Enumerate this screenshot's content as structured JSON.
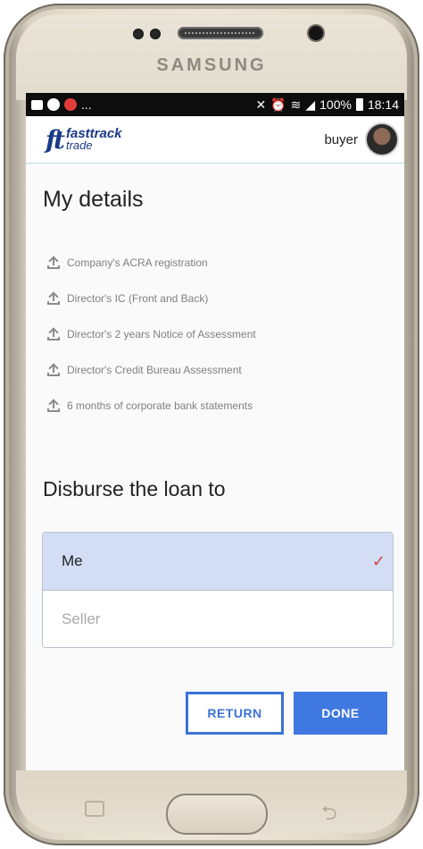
{
  "device": {
    "brand": "SAMSUNG"
  },
  "status_bar": {
    "overflow": "...",
    "battery": "100%",
    "time": "18:14"
  },
  "app_bar": {
    "logo_mark": "ft",
    "logo_line1": "fasttrack",
    "logo_line2": "trade",
    "username": "buyer"
  },
  "details": {
    "title": "My details",
    "documents": [
      {
        "label": "Company's ACRA registration"
      },
      {
        "label": "Director's IC (Front and Back)"
      },
      {
        "label": "Director's 2 years Notice of Assessment"
      },
      {
        "label": "Director's Credit Bureau Assessment"
      },
      {
        "label": "6 months of corporate bank statements"
      }
    ]
  },
  "disburse": {
    "title": "Disburse the loan to",
    "options": [
      {
        "label": "Me",
        "selected": true
      },
      {
        "label": "Seller",
        "selected": false
      }
    ],
    "check_glyph": "✓"
  },
  "actions": {
    "return_label": "RETURN",
    "done_label": "DONE"
  },
  "colors": {
    "accent": "#3f78e0",
    "selected_bg": "#d3def5",
    "check": "#d14a4a",
    "logo": "#1b3a86"
  }
}
